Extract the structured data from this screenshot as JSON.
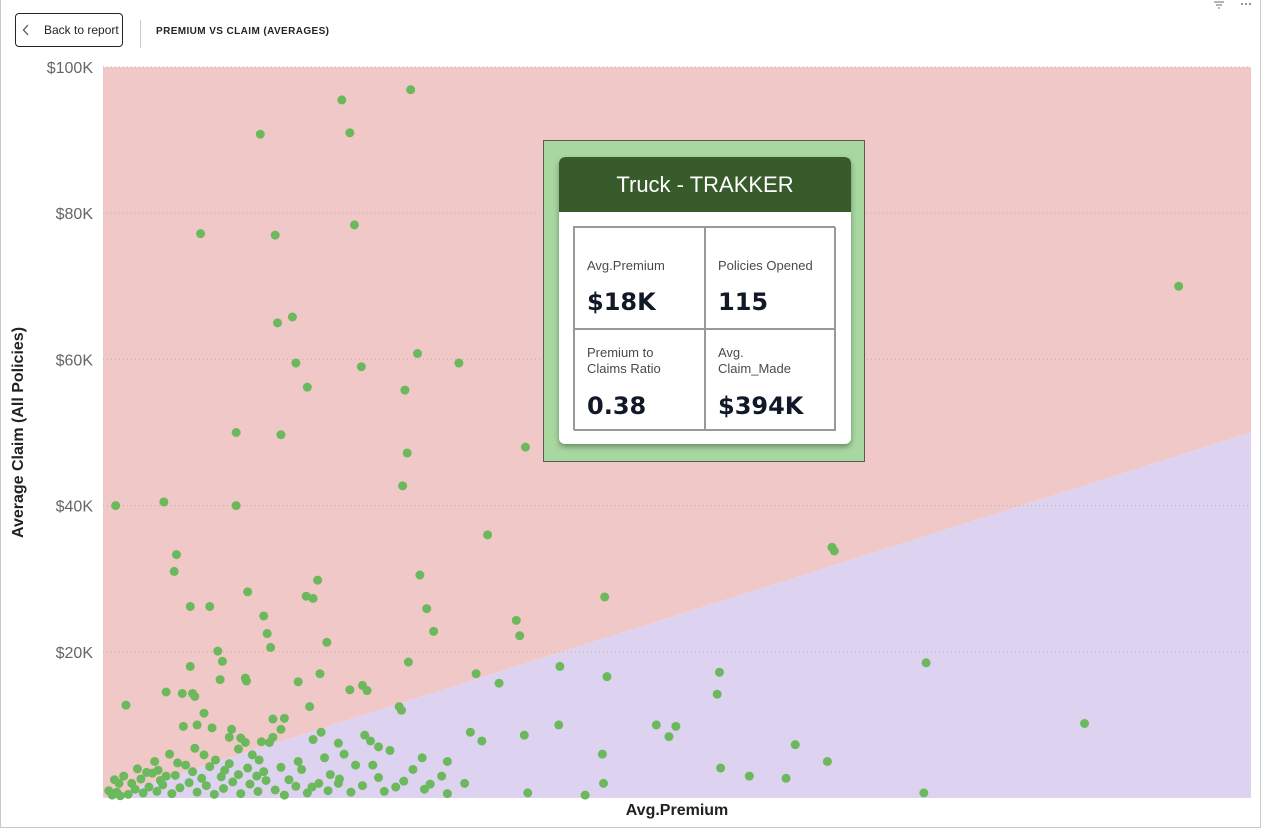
{
  "header": {
    "back_label": "Back to report",
    "page_title": "PREMIUM VS CLAIM (AVERAGES)"
  },
  "icons": {
    "back": "chevron-left-icon",
    "filter": "filter-icon",
    "more": "more-options-icon"
  },
  "colors": {
    "above_region": "#f0c8c8",
    "below_region": "#ddd3f0",
    "point": "#6cb85c",
    "tooltip_header": "#385b2c",
    "tooltip_frame": "#a8d8a0"
  },
  "tooltip": {
    "title": "Truck - TRAKKER",
    "cells": [
      {
        "label": "Avg.Premium",
        "value": "$18K"
      },
      {
        "label": "Policies Opened",
        "value": "115"
      },
      {
        "label": "Premium to Claims Ratio",
        "value": "0.38"
      },
      {
        "label": "Avg. Claim_Made",
        "value": "$394K"
      }
    ]
  },
  "chart_data": {
    "type": "scatter",
    "title": "",
    "xlabel": "Avg.Premium",
    "ylabel": "Average Claim (All Policies)",
    "xlim": [
      0,
      1000
    ],
    "ylim": [
      0,
      100000
    ],
    "y_ticks": [
      20000,
      40000,
      60000,
      80000,
      100000
    ],
    "y_tick_labels": [
      "$20K",
      "$40K",
      "$60K",
      "$80K",
      "$100K"
    ],
    "x_ticks_visible": false,
    "grid": "horizontal-dotted",
    "regions": {
      "boundary_line": {
        "from": [
          0,
          0
        ],
        "to": [
          1000,
          50000
        ]
      },
      "above": "red-shaded",
      "below": "purple-shaded"
    },
    "points": [
      [
        11,
        40000
      ],
      [
        20,
        12700
      ],
      [
        53,
        40500
      ],
      [
        62,
        31000
      ],
      [
        64,
        33300
      ],
      [
        76,
        26200
      ],
      [
        85,
        77200
      ],
      [
        93,
        26200
      ],
      [
        100,
        20100
      ],
      [
        102,
        16200
      ],
      [
        104,
        18700
      ],
      [
        116,
        40000
      ],
      [
        116,
        50000
      ],
      [
        126,
        28200
      ],
      [
        140,
        24900
      ],
      [
        143,
        22500
      ],
      [
        146,
        20600
      ],
      [
        150,
        77000
      ],
      [
        152,
        65000
      ],
      [
        155,
        49700
      ],
      [
        165,
        65800
      ],
      [
        168,
        59500
      ],
      [
        170,
        15900
      ],
      [
        177,
        27600
      ],
      [
        178,
        56200
      ],
      [
        183,
        27300
      ],
      [
        187,
        29800
      ],
      [
        189,
        17000
      ],
      [
        195,
        21300
      ],
      [
        208,
        95500
      ],
      [
        215,
        91000
      ],
      [
        219,
        78400
      ],
      [
        225,
        59000
      ],
      [
        226,
        15400
      ],
      [
        137,
        90800
      ],
      [
        261,
        42700
      ],
      [
        263,
        55800
      ],
      [
        265,
        47200
      ],
      [
        266,
        18600
      ],
      [
        274,
        60800
      ],
      [
        276,
        30500
      ],
      [
        282,
        25900
      ],
      [
        288,
        22800
      ],
      [
        260,
        12000
      ],
      [
        310,
        59500
      ],
      [
        325,
        17000
      ],
      [
        335,
        36000
      ],
      [
        345,
        15700
      ],
      [
        360,
        24300
      ],
      [
        363,
        22200
      ],
      [
        367,
        8600
      ],
      [
        368,
        48000
      ],
      [
        397,
        10000
      ],
      [
        398,
        18000
      ],
      [
        437,
        27500
      ],
      [
        436,
        2000
      ],
      [
        439,
        16600
      ],
      [
        482,
        10000
      ],
      [
        493,
        8400
      ],
      [
        499,
        9800
      ],
      [
        535,
        14200
      ],
      [
        537,
        17200
      ],
      [
        538,
        4100
      ],
      [
        563,
        3000
      ],
      [
        595,
        2700
      ],
      [
        603,
        7300
      ],
      [
        631,
        5000
      ],
      [
        635,
        34300
      ],
      [
        637,
        33800
      ],
      [
        717,
        18500
      ],
      [
        715,
        700
      ],
      [
        855,
        10200
      ],
      [
        937,
        70000
      ],
      [
        268,
        96900
      ],
      [
        435,
        6000
      ],
      [
        320,
        9000
      ],
      [
        330,
        7800
      ],
      [
        215,
        14800
      ],
      [
        230,
        14700
      ],
      [
        180,
        12500
      ],
      [
        190,
        9000
      ],
      [
        210,
        6000
      ],
      [
        235,
        4500
      ],
      [
        250,
        6500
      ],
      [
        278,
        5500
      ],
      [
        300,
        5000
      ],
      [
        315,
        2000
      ],
      [
        300,
        600
      ],
      [
        370,
        700
      ],
      [
        420,
        400
      ],
      [
        10,
        2500
      ],
      [
        18,
        3000
      ],
      [
        25,
        2000
      ],
      [
        30,
        4000
      ],
      [
        38,
        3500
      ],
      [
        45,
        5000
      ],
      [
        48,
        3800
      ],
      [
        55,
        3000
      ],
      [
        58,
        6000
      ],
      [
        65,
        4800
      ],
      [
        70,
        9800
      ],
      [
        72,
        4500
      ],
      [
        80,
        6800
      ],
      [
        88,
        5900
      ],
      [
        95,
        9600
      ],
      [
        98,
        5200
      ],
      [
        106,
        3800
      ],
      [
        112,
        9400
      ],
      [
        118,
        6700
      ],
      [
        124,
        7600
      ],
      [
        130,
        5900
      ],
      [
        136,
        5200
      ],
      [
        145,
        7600
      ],
      [
        155,
        4200
      ],
      [
        162,
        2500
      ],
      [
        173,
        3900
      ],
      [
        182,
        1500
      ],
      [
        198,
        3200
      ],
      [
        205,
        2000
      ],
      [
        220,
        4500
      ],
      [
        240,
        2800
      ],
      [
        255,
        1500
      ],
      [
        270,
        3900
      ],
      [
        285,
        1900
      ],
      [
        295,
        3000
      ],
      [
        5,
        1000
      ],
      [
        8,
        400
      ],
      [
        12,
        800
      ],
      [
        15,
        300
      ],
      [
        22,
        500
      ],
      [
        28,
        1200
      ],
      [
        35,
        700
      ],
      [
        40,
        1500
      ],
      [
        47,
        900
      ],
      [
        52,
        1800
      ],
      [
        60,
        600
      ],
      [
        67,
        1400
      ],
      [
        75,
        2100
      ],
      [
        82,
        800
      ],
      [
        90,
        1700
      ],
      [
        97,
        500
      ],
      [
        105,
        1300
      ],
      [
        113,
        2200
      ],
      [
        120,
        600
      ],
      [
        128,
        1900
      ],
      [
        135,
        900
      ],
      [
        142,
        2400
      ],
      [
        150,
        1100
      ],
      [
        158,
        400
      ],
      [
        168,
        1600
      ],
      [
        178,
        700
      ],
      [
        188,
        2000
      ],
      [
        196,
        1000
      ],
      [
        206,
        2600
      ],
      [
        216,
        800
      ],
      [
        226,
        1700
      ],
      [
        245,
        900
      ],
      [
        262,
        2300
      ],
      [
        280,
        1200
      ],
      [
        14,
        2000
      ],
      [
        33,
        2600
      ],
      [
        43,
        3400
      ],
      [
        50,
        2400
      ],
      [
        63,
        3100
      ],
      [
        78,
        3600
      ],
      [
        86,
        2700
      ],
      [
        93,
        4300
      ],
      [
        103,
        2900
      ],
      [
        110,
        4700
      ],
      [
        118,
        3200
      ],
      [
        126,
        4100
      ],
      [
        134,
        3000
      ],
      [
        140,
        3600
      ],
      [
        148,
        10800
      ],
      [
        155,
        9400
      ],
      [
        124,
        16400
      ],
      [
        125,
        16000
      ],
      [
        76,
        18000
      ],
      [
        69,
        14300
      ],
      [
        55,
        14500
      ],
      [
        80,
        13900
      ],
      [
        78,
        14300
      ],
      [
        88,
        11600
      ],
      [
        82,
        10000
      ],
      [
        110,
        8300
      ],
      [
        120,
        8200
      ],
      [
        138,
        7700
      ],
      [
        148,
        8300
      ],
      [
        158,
        10900
      ],
      [
        170,
        5000
      ],
      [
        183,
        8000
      ],
      [
        193,
        5500
      ],
      [
        205,
        7500
      ],
      [
        228,
        8600
      ],
      [
        233,
        7800
      ],
      [
        240,
        7000
      ],
      [
        258,
        12500
      ]
    ]
  }
}
